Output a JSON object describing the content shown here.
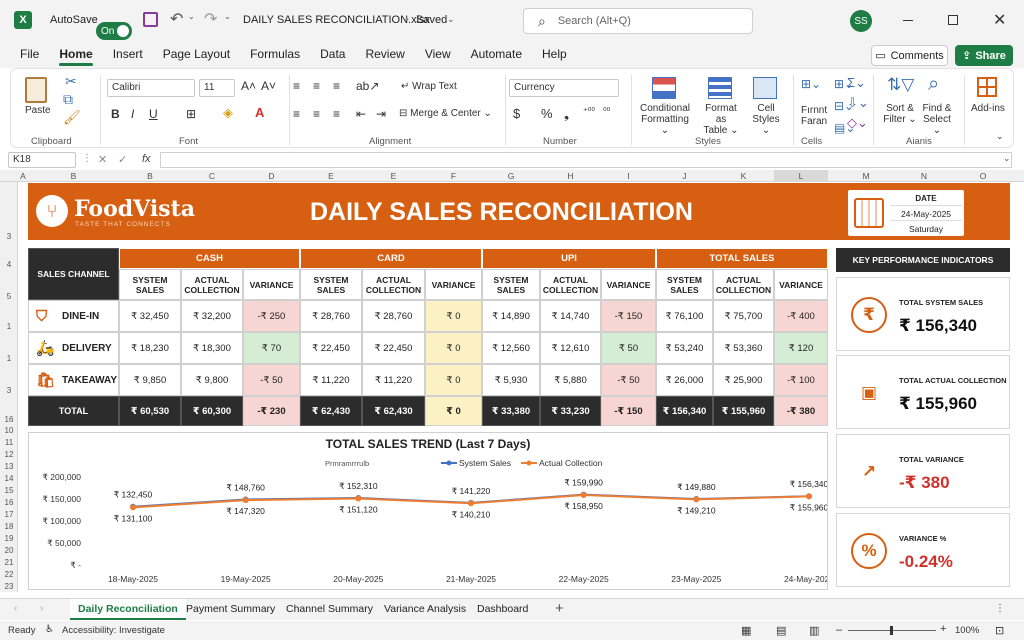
{
  "titlebar": {
    "autosave_label": "AutoSave",
    "autosave_state": "On",
    "filename": "DAILY SALES RECONCILIATION.xlsx",
    "save_state": "Saved",
    "search_placeholder": "Search (Alt+Q)",
    "user_initials": "SS"
  },
  "menu": {
    "items": [
      "File",
      "Home",
      "Insert",
      "Page Layout",
      "Formulas",
      "Data",
      "Review",
      "View",
      "Automate",
      "Help"
    ],
    "active": "Home",
    "comments_label": "Comments",
    "share_label": "Share"
  },
  "ribbon": {
    "clipboard": {
      "paste": "Paste",
      "group": "Clipboard"
    },
    "font": {
      "name": "Calibri",
      "size": "11",
      "group": "Font"
    },
    "alignment": {
      "wrap": "Wrap Text",
      "merge": "Merge & Center",
      "group": "Alignment"
    },
    "number": {
      "format": "Currency",
      "group": "Number"
    },
    "styles": {
      "cond1": "Conditional",
      "cond2": "Formatting",
      "fmt1": "Format as",
      "fmt2": "Table",
      "cell1": "Cell",
      "cell2": "Styles",
      "group": "Styles"
    },
    "cells": {
      "label1": "Cells",
      "group": "Cells"
    },
    "editing": {
      "sort1": "Sort &",
      "sort2": "Filter",
      "find1": "Find &",
      "find2": "Select",
      "group": "Editing"
    },
    "addins": {
      "label1": "Add-ins"
    }
  },
  "formula_bar": {
    "name_box": "K18",
    "fx": "fx",
    "content": ""
  },
  "columns": [
    "A",
    "B",
    "C",
    "D",
    "E",
    "F",
    "G",
    "H",
    "I",
    "J",
    "K",
    "L",
    "M",
    "N",
    "O"
  ],
  "row_numbers": [
    "3",
    "4",
    "5",
    "1",
    "3",
    "16",
    "10",
    "11",
    "12",
    "13",
    "14",
    "15",
    "16",
    "17",
    "18",
    "19",
    "20",
    "21",
    "22",
    "23",
    "24",
    "25"
  ],
  "banner": {
    "brand": "FoodVista",
    "tagline": "TASTE THAT CONNECTS",
    "title": "DAILY SALES RECONCILIATION",
    "date_label": "DATE",
    "date_value": "24-May-2025",
    "day_value": "Saturday"
  },
  "table": {
    "channel_header": "SALES CHANNEL",
    "groups": [
      "CASH",
      "CARD",
      "UPI",
      "TOTAL SALES"
    ],
    "subheaders": [
      [
        "SYSTEM",
        "SALES"
      ],
      [
        "ACTUAL",
        "COLLECTION"
      ],
      [
        "VARIANCE",
        ""
      ]
    ],
    "rows": [
      {
        "channel": "DINE-IN",
        "icon": "chair-icon",
        "values": [
          "₹ 32,450",
          "₹ 32,200",
          "-₹ 250",
          "₹ 28,760",
          "₹ 28,760",
          "₹ 0",
          "₹ 14,890",
          "₹ 14,740",
          "-₹ 150",
          "₹ 76,100",
          "₹ 75,700",
          "-₹ 400"
        ]
      },
      {
        "channel": "DELIVERY",
        "icon": "scooter-icon",
        "values": [
          "₹ 18,230",
          "₹ 18,300",
          "₹ 70",
          "₹ 22,450",
          "₹ 22,450",
          "₹ 0",
          "₹ 12,560",
          "₹ 12,610",
          "₹ 50",
          "₹ 53,240",
          "₹ 53,360",
          "₹ 120"
        ]
      },
      {
        "channel": "TAKEAWAY",
        "icon": "bag-icon",
        "values": [
          "₹ 9,850",
          "₹ 9,800",
          "-₹ 50",
          "₹ 11,220",
          "₹ 11,220",
          "₹ 0",
          "₹ 5,930",
          "₹ 5,880",
          "-₹ 50",
          "₹ 26,000",
          "₹ 25,900",
          "-₹ 100"
        ]
      }
    ],
    "total": {
      "channel": "TOTAL",
      "values": [
        "₹ 60,530",
        "₹ 60,300",
        "-₹ 230",
        "₹ 62,430",
        "₹ 62,430",
        "₹ 0",
        "₹ 33,380",
        "₹ 33,230",
        "-₹ 150",
        "₹ 156,340",
        "₹ 155,960",
        "-₹ 380"
      ]
    }
  },
  "kpi": {
    "header": "KEY PERFORMANCE INDICATORS",
    "cards": [
      {
        "label": "TOTAL SYSTEM SALES",
        "value": "₹ 156,340",
        "icon": "rupee-icon",
        "color": "#111111"
      },
      {
        "label": "TOTAL ACTUAL COLLECTION",
        "value": "₹ 155,960",
        "icon": "cash-register-icon",
        "color": "#111111"
      },
      {
        "label": "TOTAL VARIANCE",
        "value": "-₹ 380",
        "icon": "bar-chart-icon",
        "color": "#d0312d"
      },
      {
        "label": "VARIANCE %",
        "value": "-0.24%",
        "icon": "percent-icon",
        "color": "#d0312d"
      }
    ]
  },
  "chart_data": {
    "type": "line",
    "title": "TOTAL SALES TREND (Last 7 Days)",
    "legend_extra": "Prmramrrrulb",
    "categories": [
      "18-May-2025",
      "19-May-2025",
      "20-May-2025",
      "21-May-2025",
      "22-May-2025",
      "23-May-2025",
      "24-May-2025"
    ],
    "series": [
      {
        "name": "System Sales",
        "color": "#4472c4",
        "values": [
          132450,
          148760,
          152310,
          141220,
          159990,
          149880,
          156340
        ],
        "labels": [
          "₹ 132,450",
          "₹ 148,760",
          "₹ 152,310",
          "₹ 141,220",
          "₹ 159,990",
          "₹ 149,880",
          "₹ 156,340"
        ]
      },
      {
        "name": "Actual Collection",
        "color": "#ed7d31",
        "values": [
          131100,
          147320,
          151120,
          140210,
          158950,
          149210,
          155960
        ],
        "labels": [
          "₹ 131,100",
          "₹ 147,320",
          "₹ 151,120",
          "₹ 140,210",
          "₹ 158,950",
          "₹ 149,210",
          "₹ 155,960"
        ]
      }
    ],
    "yticks": [
      200000,
      150000,
      100000,
      50000,
      0
    ],
    "ytick_labels": [
      "₹ 200,000",
      "₹ 150,000",
      "₹ 100,000",
      "₹ 50,000",
      "₹ -"
    ],
    "ylim": [
      0,
      200000
    ],
    "grid": false,
    "legend": "top"
  },
  "tabs": {
    "items": [
      "Daily Reconciliation",
      "Payment Summary",
      "Channel Summary",
      "Variance Analysis",
      "Dashboard"
    ],
    "active": 0,
    "add": "+"
  },
  "status": {
    "ready": "Ready",
    "accessibility": "Accessibility: Investigate",
    "zoom": "100%"
  }
}
